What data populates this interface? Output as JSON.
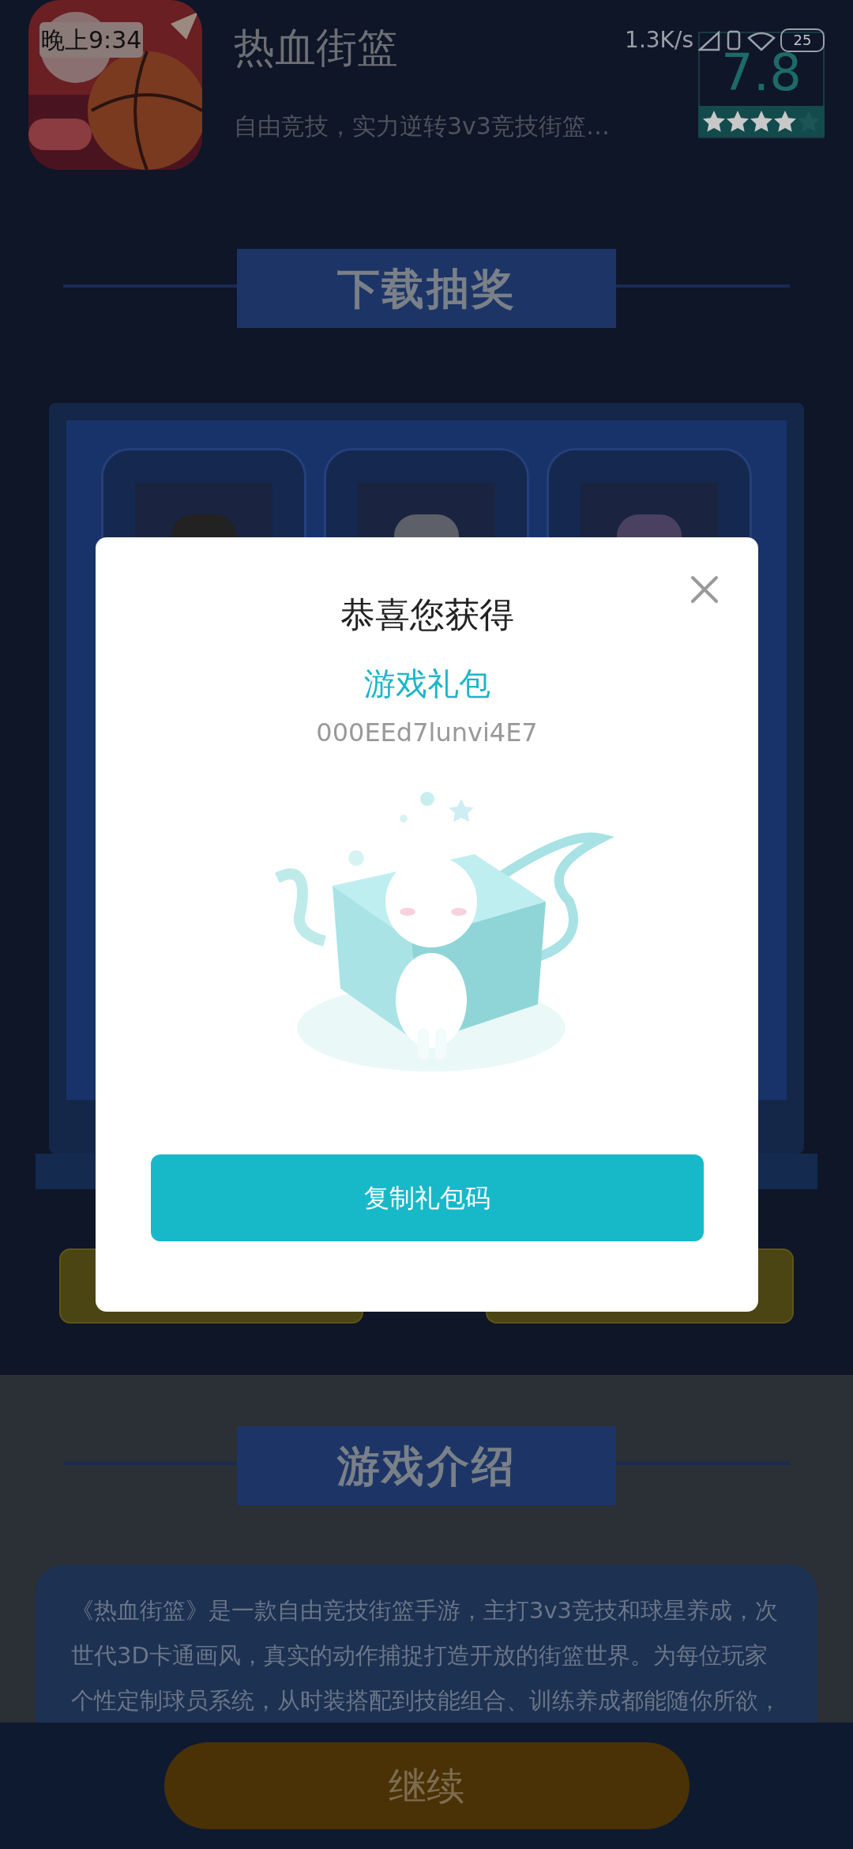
{
  "status_bar": {
    "time": "晚上9:34",
    "speed": "1.3K/s",
    "battery": "25"
  },
  "app": {
    "title": "热血街篮",
    "subtitle": "自由竞技，实力逆转3v3竞技街篮…",
    "rating": "7.8",
    "stars": 4
  },
  "lottery": {
    "heading": "下载抽奖"
  },
  "dialog": {
    "title": "恭喜您获得",
    "prize": "游戏礼包",
    "code": "000EEd7lunvi4E7",
    "button": "复制礼包码"
  },
  "intro": {
    "heading": "游戏介绍",
    "text": "《热血街篮》是一款自由竞技街篮手游，主打3v3竞技和球星养成，次世代3D卡通画风，真实的动作捕捉打造开放的街篮世界。为每位玩家个性定制球员系统，从时装搭配到技能组合、训练养成都能随你所欲，"
  },
  "continue_button": "继续"
}
